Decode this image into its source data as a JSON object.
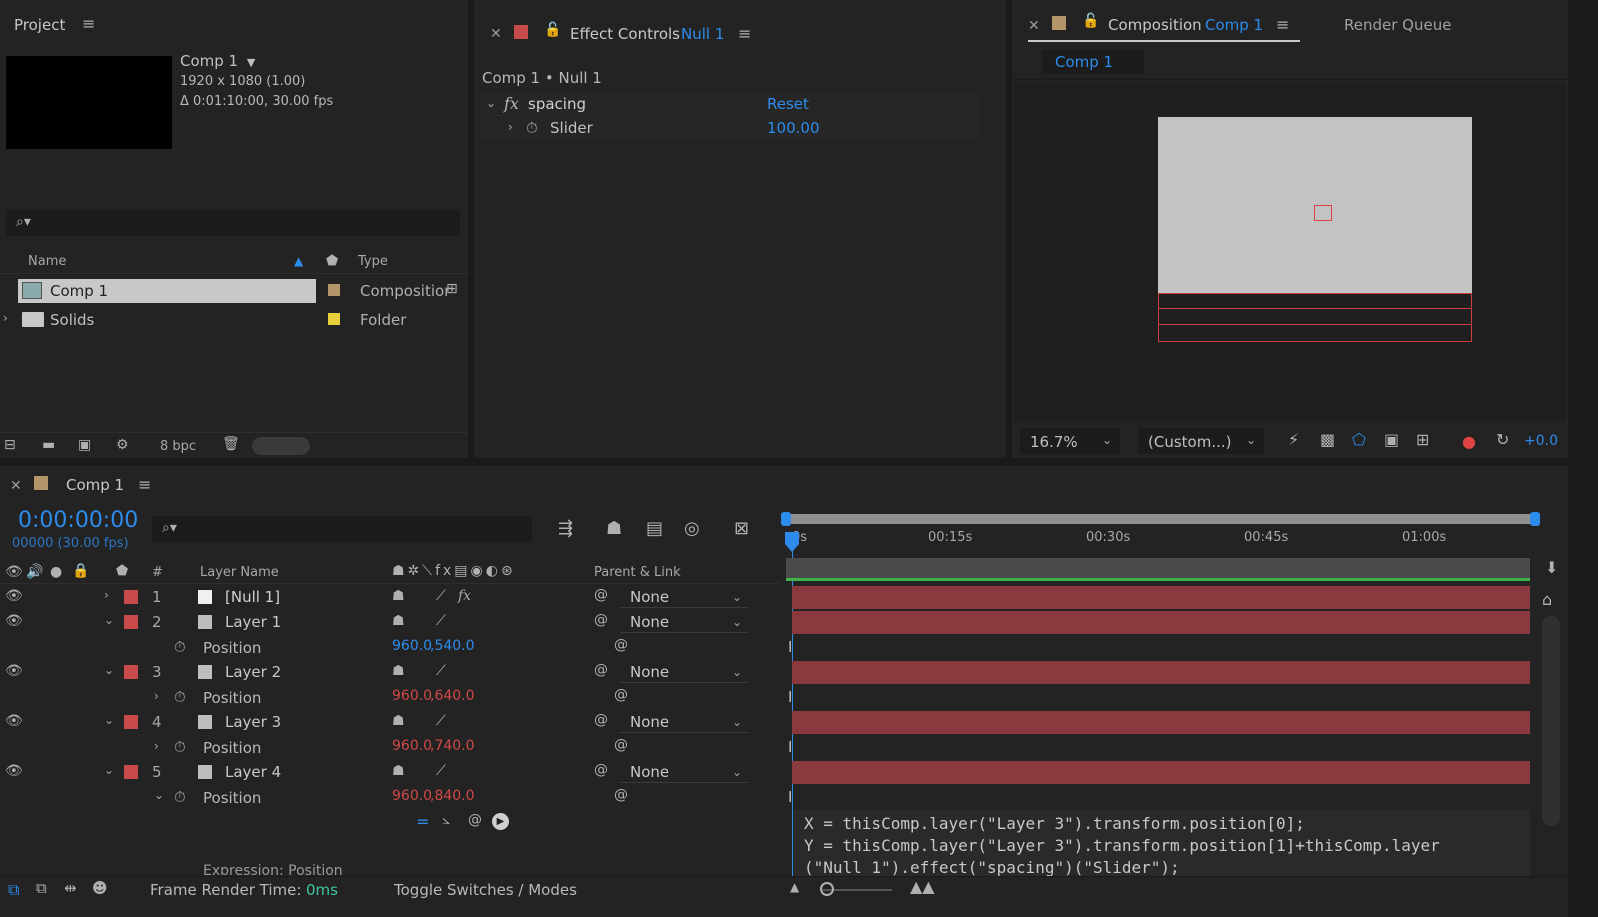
{
  "project": {
    "title": "Project",
    "comp_name": "Comp 1",
    "comp_res": "1920 x 1080 (1.00)",
    "comp_duration": "Δ 0:01:10:00, 30.00 fps",
    "columns": {
      "name": "Name",
      "type": "Type"
    },
    "items": [
      {
        "name": "Comp 1",
        "type": "Compositior",
        "color": "#b4956a"
      },
      {
        "name": "Solids",
        "type": "Folder",
        "color": "#e8d03c"
      }
    ],
    "bpc": "8 bpc"
  },
  "effect_controls": {
    "title": "Effect Controls",
    "target": "Null 1",
    "breadcrumb": "Comp 1 • Null 1",
    "effect_name": "spacing",
    "reset_label": "Reset",
    "property_name": "Slider",
    "property_value": "100.00"
  },
  "composition": {
    "title": "Composition",
    "comp_link": "Comp 1",
    "render_queue": "Render Queue",
    "tab": "Comp 1",
    "zoom": "16.7%",
    "resolution": "(Custom...)",
    "exposure": "+0.0"
  },
  "timeline": {
    "title": "Comp 1",
    "timecode": "0:00:00:00",
    "frame_info": "00000 (30.00 fps)",
    "col_layer_name": "Layer Name",
    "col_num": "#",
    "col_parent": "Parent & Link",
    "ruler": [
      "0s",
      "00:15s",
      "00:30s",
      "00:45s",
      "01:00s"
    ],
    "layers": [
      {
        "num": "1",
        "name": "[Null 1]",
        "parent": "None"
      },
      {
        "num": "2",
        "name": "Layer 1",
        "parent": "None",
        "pos_label": "Position",
        "pos_x": "960.0",
        "pos_y": ",540.0"
      },
      {
        "num": "3",
        "name": "Layer 2",
        "parent": "None",
        "pos_label": "Position",
        "pos_x": "960.0",
        "pos_y": ",640.0"
      },
      {
        "num": "4",
        "name": "Layer 3",
        "parent": "None",
        "pos_label": "Position",
        "pos_x": "960.0",
        "pos_y": ",740.0"
      },
      {
        "num": "5",
        "name": "Layer 4",
        "parent": "None",
        "pos_label": "Position",
        "pos_x": "960.0",
        "pos_y": ",840.0"
      }
    ],
    "expression_label": "Expression: Position",
    "expression_lines": [
      "X = thisComp.layer(\"Layer 3\").transform.position[0];",
      "Y = thisComp.layer(\"Layer 3\").transform.position[1]+thisComp.layer",
      "(\"Null 1\").effect(\"spacing\")(\"Slider\");"
    ],
    "frame_render_label": "Frame Render Time:",
    "frame_render_value": "0ms",
    "toggle_label": "Toggle Switches / Modes"
  },
  "colors": {
    "accent": "#2d8ceb",
    "layer_red": "#c84a4a",
    "layer_bar": "#8a3a3e"
  }
}
